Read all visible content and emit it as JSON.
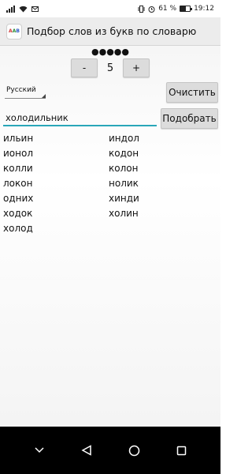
{
  "status": {
    "battery": "61 %",
    "time": "19:12"
  },
  "app": {
    "icon_text": [
      "A",
      "A",
      "B"
    ],
    "title": "Подбор слов из букв по словарю"
  },
  "controls": {
    "dots": "●●●●●",
    "minus_label": "-",
    "count": "5",
    "plus_label": "+",
    "language": "Русский",
    "clear_label": "Очистить",
    "pick_label": "Подобрать",
    "input_value": "холодильник"
  },
  "results": {
    "column1": [
      "ильин",
      "ионол",
      "колли",
      "локон",
      "одних",
      "ходок",
      "холод"
    ],
    "column2": [
      "индол",
      "кодон",
      "колон",
      "нолик",
      "хинди",
      "холин"
    ]
  },
  "colors": {
    "input_underline": "#2aa7b9",
    "app_bar": "#ececec",
    "nav_bar": "#000000"
  }
}
